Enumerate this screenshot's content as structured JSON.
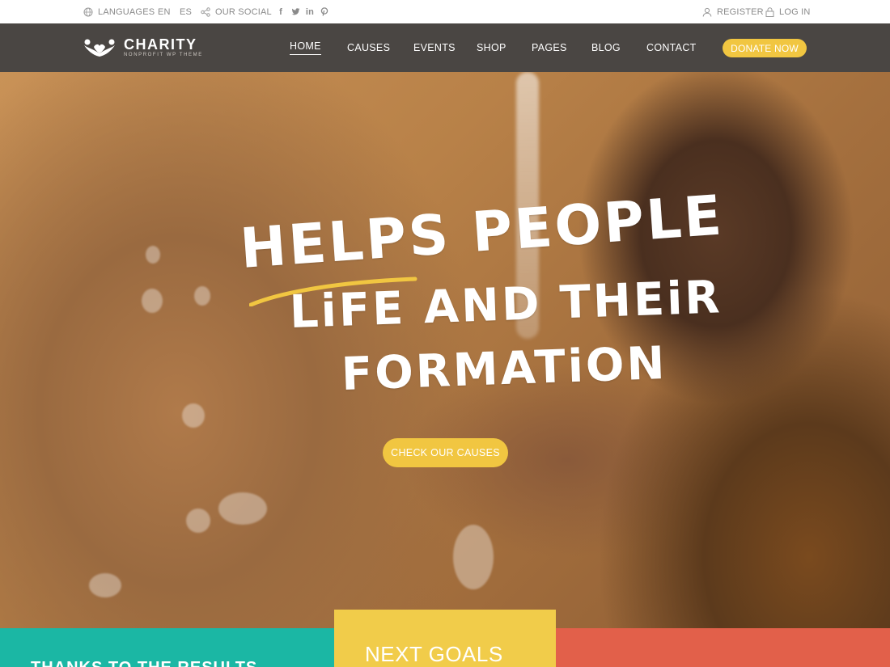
{
  "topbar": {
    "languages_label": "LANGUAGES",
    "lang_en": "EN",
    "lang_es": "ES",
    "social_label": "OUR SOCIAL",
    "social_icons": [
      "facebook-icon",
      "twitter-icon",
      "linkedin-icon",
      "pinterest-icon"
    ],
    "register_label": "REGISTER",
    "login_label": "LOG IN"
  },
  "brand": {
    "name": "CHARITY",
    "tagline": "NONPROFIT WP THEME"
  },
  "nav": {
    "items": [
      "HOME",
      "CAUSES",
      "EVENTS",
      "SHOP",
      "PAGES",
      "BLOG",
      "CONTACT"
    ],
    "active": "HOME",
    "donate_label": "DONATE NOW"
  },
  "hero": {
    "line1": "HELPS PEOPLE",
    "line2": "LiFE AND THEiR",
    "line3": "FORMATiON",
    "cta_label": "CHECK OUR CAUSES"
  },
  "panels": {
    "left_title": "THANKS TO THE RESULTS",
    "middle_title": "NEXT GOALS"
  },
  "colors": {
    "accent_yellow": "#f1c641",
    "nav_bg": "#4a4643",
    "teal": "#1bb7a4",
    "coral": "#e2604a",
    "panel_yellow": "#f1cc4a"
  }
}
